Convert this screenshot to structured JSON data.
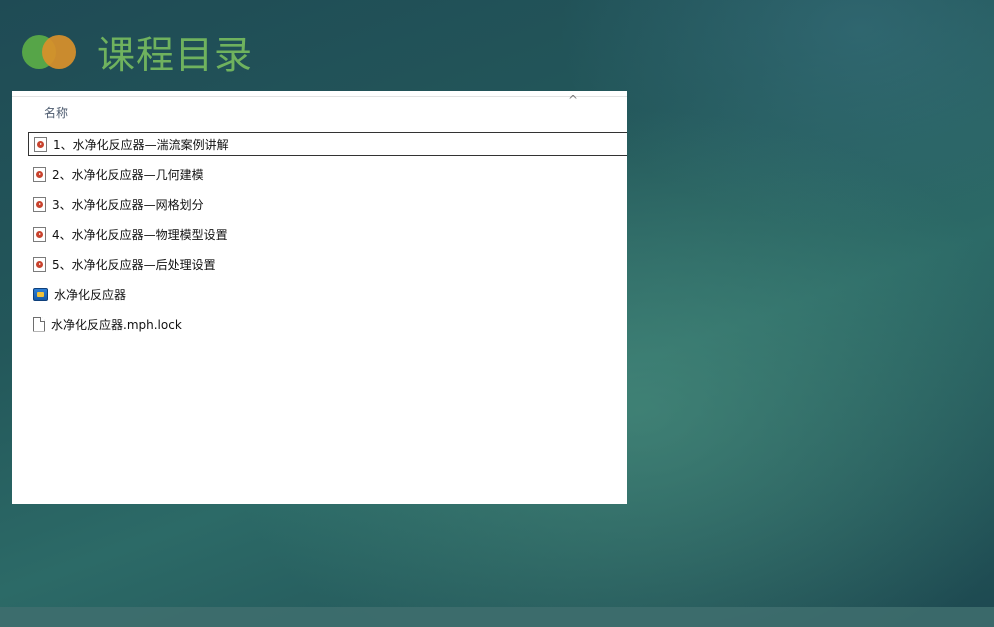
{
  "slide": {
    "title": "课程目录"
  },
  "explorer": {
    "column_header": "名称",
    "sort_indicator": "^",
    "items": [
      {
        "name": "1、水净化反应器—湍流案例讲解",
        "icon": "video-file-icon",
        "selected": true
      },
      {
        "name": "2、水净化反应器—几何建模",
        "icon": "video-file-icon",
        "selected": false
      },
      {
        "name": "3、水净化反应器—网格划分",
        "icon": "video-file-icon",
        "selected": false
      },
      {
        "name": "4、水净化反应器—物理模型设置",
        "icon": "video-file-icon",
        "selected": false
      },
      {
        "name": "5、水净化反应器—后处理设置",
        "icon": "video-file-icon",
        "selected": false
      },
      {
        "name": "水净化反应器",
        "icon": "comsol-file-icon",
        "selected": false
      },
      {
        "name": "水净化反应器.mph.lock",
        "icon": "blank-file-icon",
        "selected": false
      }
    ]
  },
  "colors": {
    "title": "#6fb25e",
    "logo_green": "#56a548",
    "logo_orange": "#d9902a",
    "background": "#23575a"
  }
}
